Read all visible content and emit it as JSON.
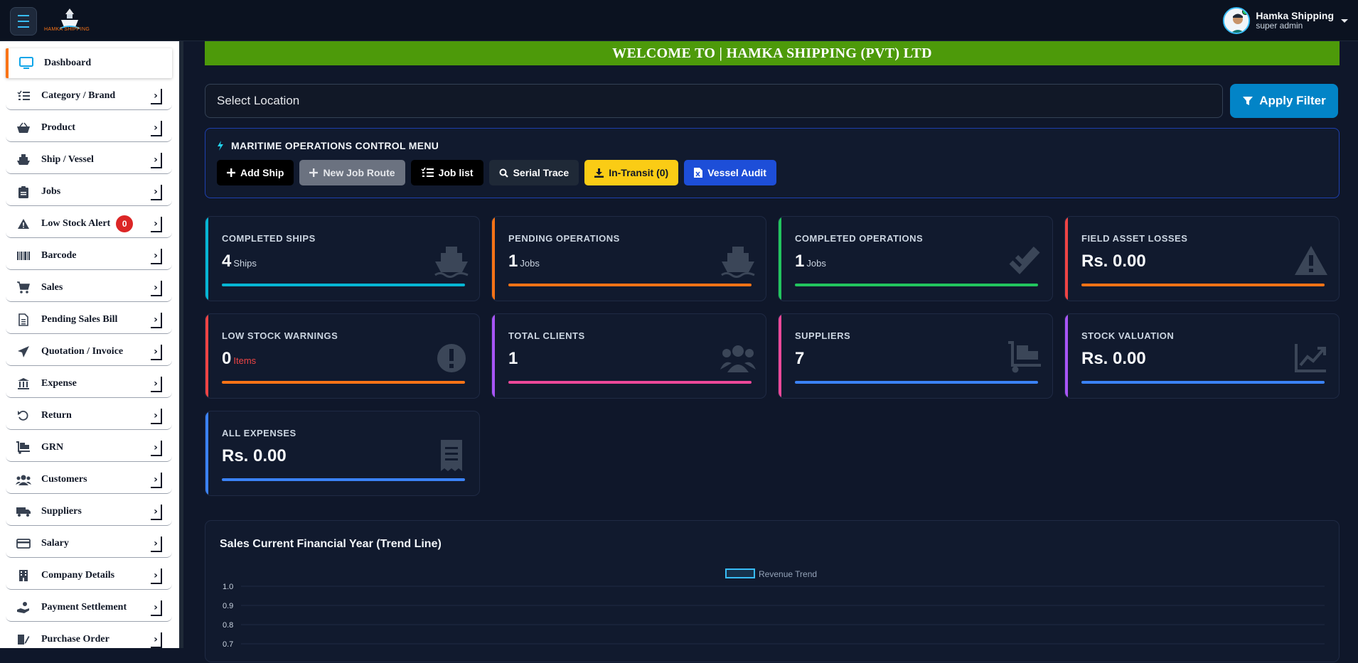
{
  "header": {
    "logo_text": "HAMKA SHIPPING",
    "user_name": "Hamka Shipping",
    "user_role": "super admin"
  },
  "sidebar": {
    "items": [
      {
        "label": "Dashboard",
        "icon": "monitor-icon"
      },
      {
        "label": "Category / Brand",
        "icon": "list-icon"
      },
      {
        "label": "Product",
        "icon": "basket-icon"
      },
      {
        "label": "Ship / Vessel",
        "icon": "ship-icon"
      },
      {
        "label": "Jobs",
        "icon": "clipboard-icon"
      },
      {
        "label": "Low Stock Alert",
        "icon": "warning-icon",
        "badge": "0"
      },
      {
        "label": "Barcode",
        "icon": "barcode-icon"
      },
      {
        "label": "Sales",
        "icon": "cart-icon"
      },
      {
        "label": "Pending Sales Bill",
        "icon": "document-icon"
      },
      {
        "label": "Quotation / Invoice",
        "icon": "paper-plane-icon"
      },
      {
        "label": "Expense",
        "icon": "bank-icon"
      },
      {
        "label": "Return",
        "icon": "undo-icon"
      },
      {
        "label": "GRN",
        "icon": "dolly-icon"
      },
      {
        "label": "Customers",
        "icon": "users-icon"
      },
      {
        "label": "Suppliers",
        "icon": "truck-icon"
      },
      {
        "label": "Salary",
        "icon": "credit-card-icon"
      },
      {
        "label": "Company Details",
        "icon": "building-icon"
      },
      {
        "label": "Payment Settlement",
        "icon": "hand-coin-icon"
      },
      {
        "label": "Purchase Order",
        "icon": "edit-document-icon"
      }
    ]
  },
  "welcome": {
    "text": "WELCOME TO | HAMKA SHIPPING (PVT) LTD"
  },
  "filter": {
    "location_placeholder": "Select Location",
    "apply_label": "Apply Filter"
  },
  "ops": {
    "title": "MARITIME OPERATIONS CONTROL MENU",
    "buttons": [
      {
        "label": "Add Ship",
        "bg": "#000000",
        "fg": "#ffffff",
        "icon": "plus-icon"
      },
      {
        "label": "New Job Route",
        "bg": "#6b7280",
        "fg": "#e5e7eb",
        "icon": "plus-icon"
      },
      {
        "label": "Job list",
        "bg": "#000000",
        "fg": "#ffffff",
        "icon": "list-icon"
      },
      {
        "label": "Serial Trace",
        "bg": "#1f2937",
        "fg": "#ffffff",
        "icon": "search-icon"
      },
      {
        "label": "In-Transit (0)",
        "bg": "#facc15",
        "fg": "#111827",
        "icon": "download-icon"
      },
      {
        "label": "Vessel Audit",
        "bg": "#1d4ed8",
        "fg": "#ffffff",
        "icon": "excel-file-icon"
      }
    ]
  },
  "stats": [
    {
      "title": "COMPLETED SHIPS",
      "value": "4",
      "unit": "Ships",
      "accent": "#06b6d4",
      "icon": "ship-icon"
    },
    {
      "title": "PENDING OPERATIONS",
      "value": "1",
      "unit": "Jobs",
      "accent": "#f97316",
      "icon": "ship-icon"
    },
    {
      "title": "COMPLETED OPERATIONS",
      "value": "1",
      "unit": "Jobs",
      "accent": "#22c55e",
      "icon": "double-check-icon"
    },
    {
      "title": "FIELD ASSET LOSSES",
      "value": "Rs. 0.00",
      "unit": "",
      "accent": "#f97316",
      "side": "#ef4444",
      "icon": "warning-icon"
    },
    {
      "title": "LOW STOCK WARNINGS",
      "value": "0",
      "unit": "Items",
      "accent": "#f97316",
      "side": "#ef4444",
      "icon": "exclamation-circle-icon"
    },
    {
      "title": "TOTAL CLIENTS",
      "value": "1",
      "unit": "",
      "accent": "#ec4899",
      "side": "#a855f7",
      "icon": "users-icon"
    },
    {
      "title": "SUPPLIERS",
      "value": "7",
      "unit": "",
      "accent": "#3b82f6",
      "side": "#ec4899",
      "icon": "dolly-icon"
    },
    {
      "title": "STOCK VALUATION",
      "value": "Rs. 0.00",
      "unit": "",
      "accent": "#3b82f6",
      "side": "#a855f7",
      "icon": "chart-up-icon"
    },
    {
      "title": "ALL EXPENSES",
      "value": "Rs. 0.00",
      "unit": "",
      "accent": "#3b82f6",
      "side": "#3b82f6",
      "icon": "receipt-icon"
    }
  ],
  "chart_data": {
    "type": "line",
    "title": "Sales Current Financial Year (Trend Line)",
    "series": [
      {
        "name": "Revenue Trend",
        "values": []
      }
    ],
    "y_ticks": [
      "1.0",
      "0.9",
      "0.8",
      "0.7"
    ],
    "ylim": [
      0,
      1.0
    ],
    "legend": "top-center",
    "grid": true,
    "color": "#38bdf8"
  }
}
